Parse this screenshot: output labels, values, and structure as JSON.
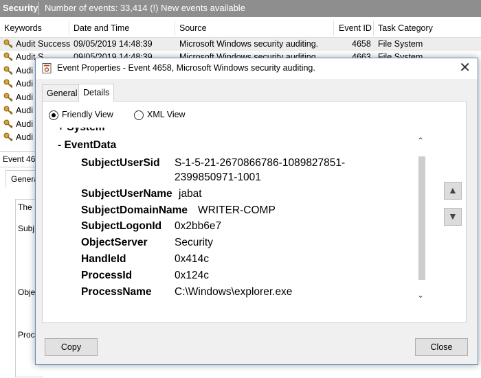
{
  "header": {
    "log_name": "Security",
    "info": "Number of events: 33,414 (!) New events available"
  },
  "columns": [
    "Keywords",
    "Date and Time",
    "Source",
    "Event ID",
    "Task Category"
  ],
  "rows": [
    {
      "keyword": "Audit Success",
      "date": "09/05/2019 14:48:39",
      "source": "Microsoft Windows security auditing.",
      "event_id": "4658",
      "category": "File System"
    },
    {
      "keyword": "Audit S",
      "date": "09/05/2019 14:48:39",
      "source": "Microsoft Windows security auditing.",
      "event_id": "4663",
      "category": "File System"
    },
    {
      "keyword": "Audi"
    },
    {
      "keyword": "Audi"
    },
    {
      "keyword": "Audi"
    },
    {
      "keyword": "Audi"
    },
    {
      "keyword": "Audi"
    },
    {
      "keyword": "Audi"
    }
  ],
  "lower": {
    "header": "Event 46",
    "tab": "Genera",
    "fragments": [
      "The",
      "Subj",
      "Obje",
      "Proc"
    ]
  },
  "dialog": {
    "title": "Event Properties - Event 4658, Microsoft Windows security auditing.",
    "close_glyph": "✕",
    "tabs": [
      "General",
      "Details"
    ],
    "active_tab": "Details",
    "radio_friendly": "Friendly View",
    "radio_xml": "XML View",
    "selected_view": "Friendly View",
    "tree": {
      "system_label": "+ System",
      "eventdata_label": "- EventData",
      "fields": [
        {
          "name": "SubjectUserSid",
          "value_line1": "S-1-5-21-2670866786-1089827851-",
          "value_line2": "2399850971-1001"
        },
        {
          "name": "SubjectUserName",
          "value": "jabat"
        },
        {
          "name": "SubjectDomainName",
          "value": "WRITER-COMP"
        },
        {
          "name": "SubjectLogonId",
          "value": "0x2bb6e7"
        },
        {
          "name": "ObjectServer",
          "value": "Security"
        },
        {
          "name": "HandleId",
          "value": "0x414c"
        },
        {
          "name": "ProcessId",
          "value": "0x124c"
        },
        {
          "name": "ProcessName",
          "value": "C:\\Windows\\explorer.exe"
        }
      ]
    },
    "copy_label": "Copy",
    "close_label": "Close"
  },
  "icons": {
    "key": "key-icon",
    "event": "event-properties-icon",
    "up": "arrow-up-icon",
    "down": "arrow-down-icon"
  }
}
